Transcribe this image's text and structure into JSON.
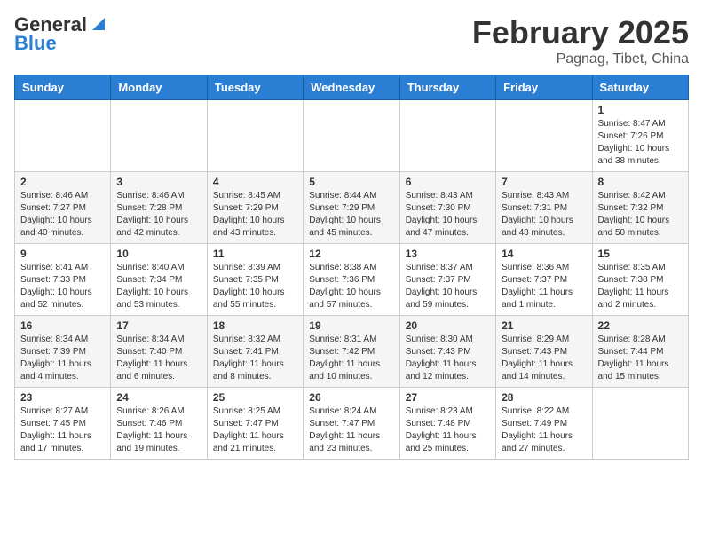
{
  "header": {
    "logo_line1": "General",
    "logo_line2": "Blue",
    "title": "February 2025",
    "subtitle": "Pagnag, Tibet, China"
  },
  "weekdays": [
    "Sunday",
    "Monday",
    "Tuesday",
    "Wednesday",
    "Thursday",
    "Friday",
    "Saturday"
  ],
  "weeks": [
    [
      {
        "day": "",
        "info": ""
      },
      {
        "day": "",
        "info": ""
      },
      {
        "day": "",
        "info": ""
      },
      {
        "day": "",
        "info": ""
      },
      {
        "day": "",
        "info": ""
      },
      {
        "day": "",
        "info": ""
      },
      {
        "day": "1",
        "info": "Sunrise: 8:47 AM\nSunset: 7:26 PM\nDaylight: 10 hours\nand 38 minutes."
      }
    ],
    [
      {
        "day": "2",
        "info": "Sunrise: 8:46 AM\nSunset: 7:27 PM\nDaylight: 10 hours\nand 40 minutes."
      },
      {
        "day": "3",
        "info": "Sunrise: 8:46 AM\nSunset: 7:28 PM\nDaylight: 10 hours\nand 42 minutes."
      },
      {
        "day": "4",
        "info": "Sunrise: 8:45 AM\nSunset: 7:29 PM\nDaylight: 10 hours\nand 43 minutes."
      },
      {
        "day": "5",
        "info": "Sunrise: 8:44 AM\nSunset: 7:29 PM\nDaylight: 10 hours\nand 45 minutes."
      },
      {
        "day": "6",
        "info": "Sunrise: 8:43 AM\nSunset: 7:30 PM\nDaylight: 10 hours\nand 47 minutes."
      },
      {
        "day": "7",
        "info": "Sunrise: 8:43 AM\nSunset: 7:31 PM\nDaylight: 10 hours\nand 48 minutes."
      },
      {
        "day": "8",
        "info": "Sunrise: 8:42 AM\nSunset: 7:32 PM\nDaylight: 10 hours\nand 50 minutes."
      }
    ],
    [
      {
        "day": "9",
        "info": "Sunrise: 8:41 AM\nSunset: 7:33 PM\nDaylight: 10 hours\nand 52 minutes."
      },
      {
        "day": "10",
        "info": "Sunrise: 8:40 AM\nSunset: 7:34 PM\nDaylight: 10 hours\nand 53 minutes."
      },
      {
        "day": "11",
        "info": "Sunrise: 8:39 AM\nSunset: 7:35 PM\nDaylight: 10 hours\nand 55 minutes."
      },
      {
        "day": "12",
        "info": "Sunrise: 8:38 AM\nSunset: 7:36 PM\nDaylight: 10 hours\nand 57 minutes."
      },
      {
        "day": "13",
        "info": "Sunrise: 8:37 AM\nSunset: 7:37 PM\nDaylight: 10 hours\nand 59 minutes."
      },
      {
        "day": "14",
        "info": "Sunrise: 8:36 AM\nSunset: 7:37 PM\nDaylight: 11 hours\nand 1 minute."
      },
      {
        "day": "15",
        "info": "Sunrise: 8:35 AM\nSunset: 7:38 PM\nDaylight: 11 hours\nand 2 minutes."
      }
    ],
    [
      {
        "day": "16",
        "info": "Sunrise: 8:34 AM\nSunset: 7:39 PM\nDaylight: 11 hours\nand 4 minutes."
      },
      {
        "day": "17",
        "info": "Sunrise: 8:34 AM\nSunset: 7:40 PM\nDaylight: 11 hours\nand 6 minutes."
      },
      {
        "day": "18",
        "info": "Sunrise: 8:32 AM\nSunset: 7:41 PM\nDaylight: 11 hours\nand 8 minutes."
      },
      {
        "day": "19",
        "info": "Sunrise: 8:31 AM\nSunset: 7:42 PM\nDaylight: 11 hours\nand 10 minutes."
      },
      {
        "day": "20",
        "info": "Sunrise: 8:30 AM\nSunset: 7:43 PM\nDaylight: 11 hours\nand 12 minutes."
      },
      {
        "day": "21",
        "info": "Sunrise: 8:29 AM\nSunset: 7:43 PM\nDaylight: 11 hours\nand 14 minutes."
      },
      {
        "day": "22",
        "info": "Sunrise: 8:28 AM\nSunset: 7:44 PM\nDaylight: 11 hours\nand 15 minutes."
      }
    ],
    [
      {
        "day": "23",
        "info": "Sunrise: 8:27 AM\nSunset: 7:45 PM\nDaylight: 11 hours\nand 17 minutes."
      },
      {
        "day": "24",
        "info": "Sunrise: 8:26 AM\nSunset: 7:46 PM\nDaylight: 11 hours\nand 19 minutes."
      },
      {
        "day": "25",
        "info": "Sunrise: 8:25 AM\nSunset: 7:47 PM\nDaylight: 11 hours\nand 21 minutes."
      },
      {
        "day": "26",
        "info": "Sunrise: 8:24 AM\nSunset: 7:47 PM\nDaylight: 11 hours\nand 23 minutes."
      },
      {
        "day": "27",
        "info": "Sunrise: 8:23 AM\nSunset: 7:48 PM\nDaylight: 11 hours\nand 25 minutes."
      },
      {
        "day": "28",
        "info": "Sunrise: 8:22 AM\nSunset: 7:49 PM\nDaylight: 11 hours\nand 27 minutes."
      },
      {
        "day": "",
        "info": ""
      }
    ]
  ]
}
